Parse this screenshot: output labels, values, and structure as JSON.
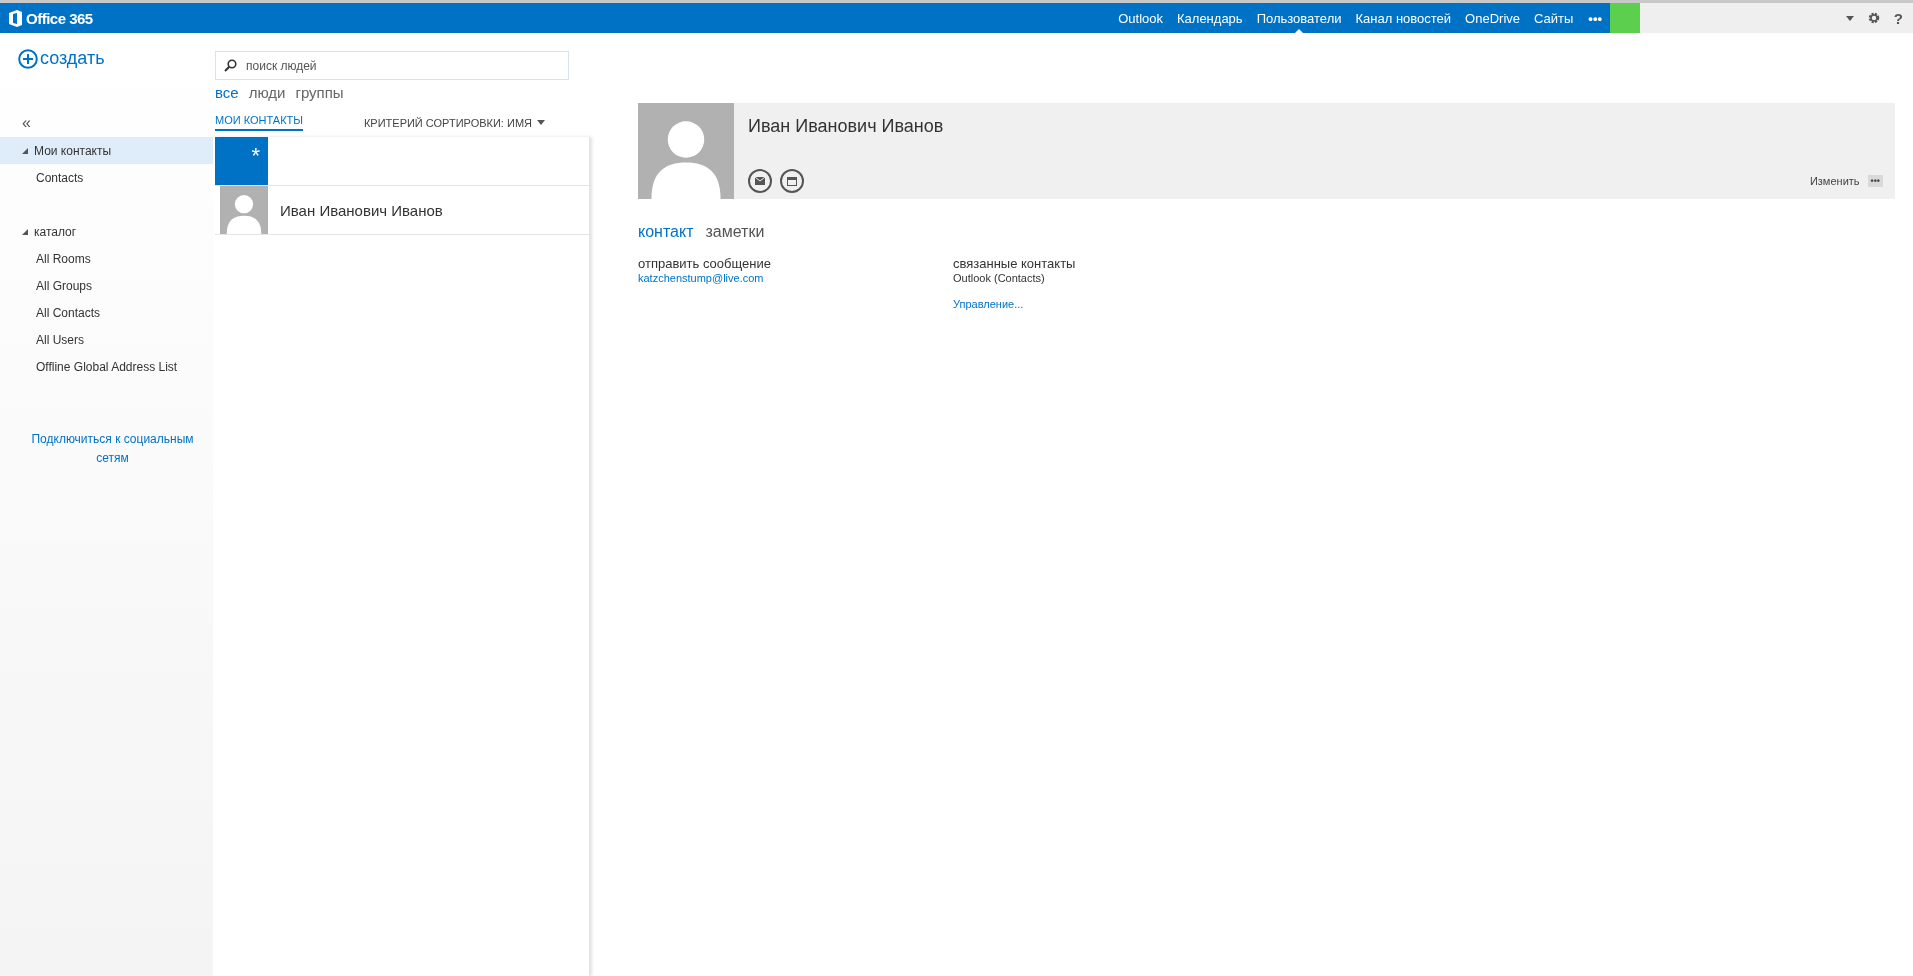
{
  "topbar": {
    "logo": "Office 365",
    "nav": [
      {
        "label": "Outlook",
        "selected": false
      },
      {
        "label": "Календарь",
        "selected": false
      },
      {
        "label": "Пользователи",
        "selected": true
      },
      {
        "label": "Канал новостей",
        "selected": false
      },
      {
        "label": "OneDrive",
        "selected": false
      },
      {
        "label": "Сайты",
        "selected": false
      }
    ],
    "more": "•••",
    "help": "?"
  },
  "create": {
    "label": "создать"
  },
  "search": {
    "placeholder": "поиск людей"
  },
  "filters": [
    {
      "label": "все",
      "selected": true
    },
    {
      "label": "люди",
      "selected": false
    },
    {
      "label": "группы",
      "selected": false
    }
  ],
  "sidebar": {
    "collapse": "«",
    "sections": [
      {
        "label": "Мои контакты",
        "expanded": true,
        "selected": true,
        "children": [
          {
            "label": "Contacts",
            "selected": false
          }
        ]
      },
      {
        "label": "каталог",
        "expanded": true,
        "selected": false,
        "children": [
          {
            "label": "All Rooms",
            "selected": false
          },
          {
            "label": "All Groups",
            "selected": false
          },
          {
            "label": "All Contacts",
            "selected": false
          },
          {
            "label": "All Users",
            "selected": false
          },
          {
            "label": "Offline Global Address List",
            "selected": false
          }
        ]
      }
    ],
    "social_link": "Подключиться к социальным сетям"
  },
  "list": {
    "tab": "МОИ КОНТАКТЫ",
    "sort": "КРИТЕРИЙ СОРТИРОВКИ: ИМЯ",
    "group_letter": "*",
    "contacts": [
      {
        "name": "Иван Иванович Иванов"
      }
    ]
  },
  "profile": {
    "name": "Иван Иванович Иванов",
    "edit": "Изменить",
    "more": "•••",
    "tabs": [
      {
        "label": "контакт",
        "selected": true
      },
      {
        "label": "заметки",
        "selected": false
      }
    ],
    "columns": [
      {
        "heading": "отправить сообщение",
        "items": [
          {
            "text": "katzchenstump@live.com",
            "kind": "link"
          }
        ]
      },
      {
        "heading": "связанные контакты",
        "items": [
          {
            "text": "Outlook (Contacts)",
            "kind": "text"
          },
          {
            "text": "Управление...",
            "kind": "link"
          }
        ]
      }
    ]
  }
}
